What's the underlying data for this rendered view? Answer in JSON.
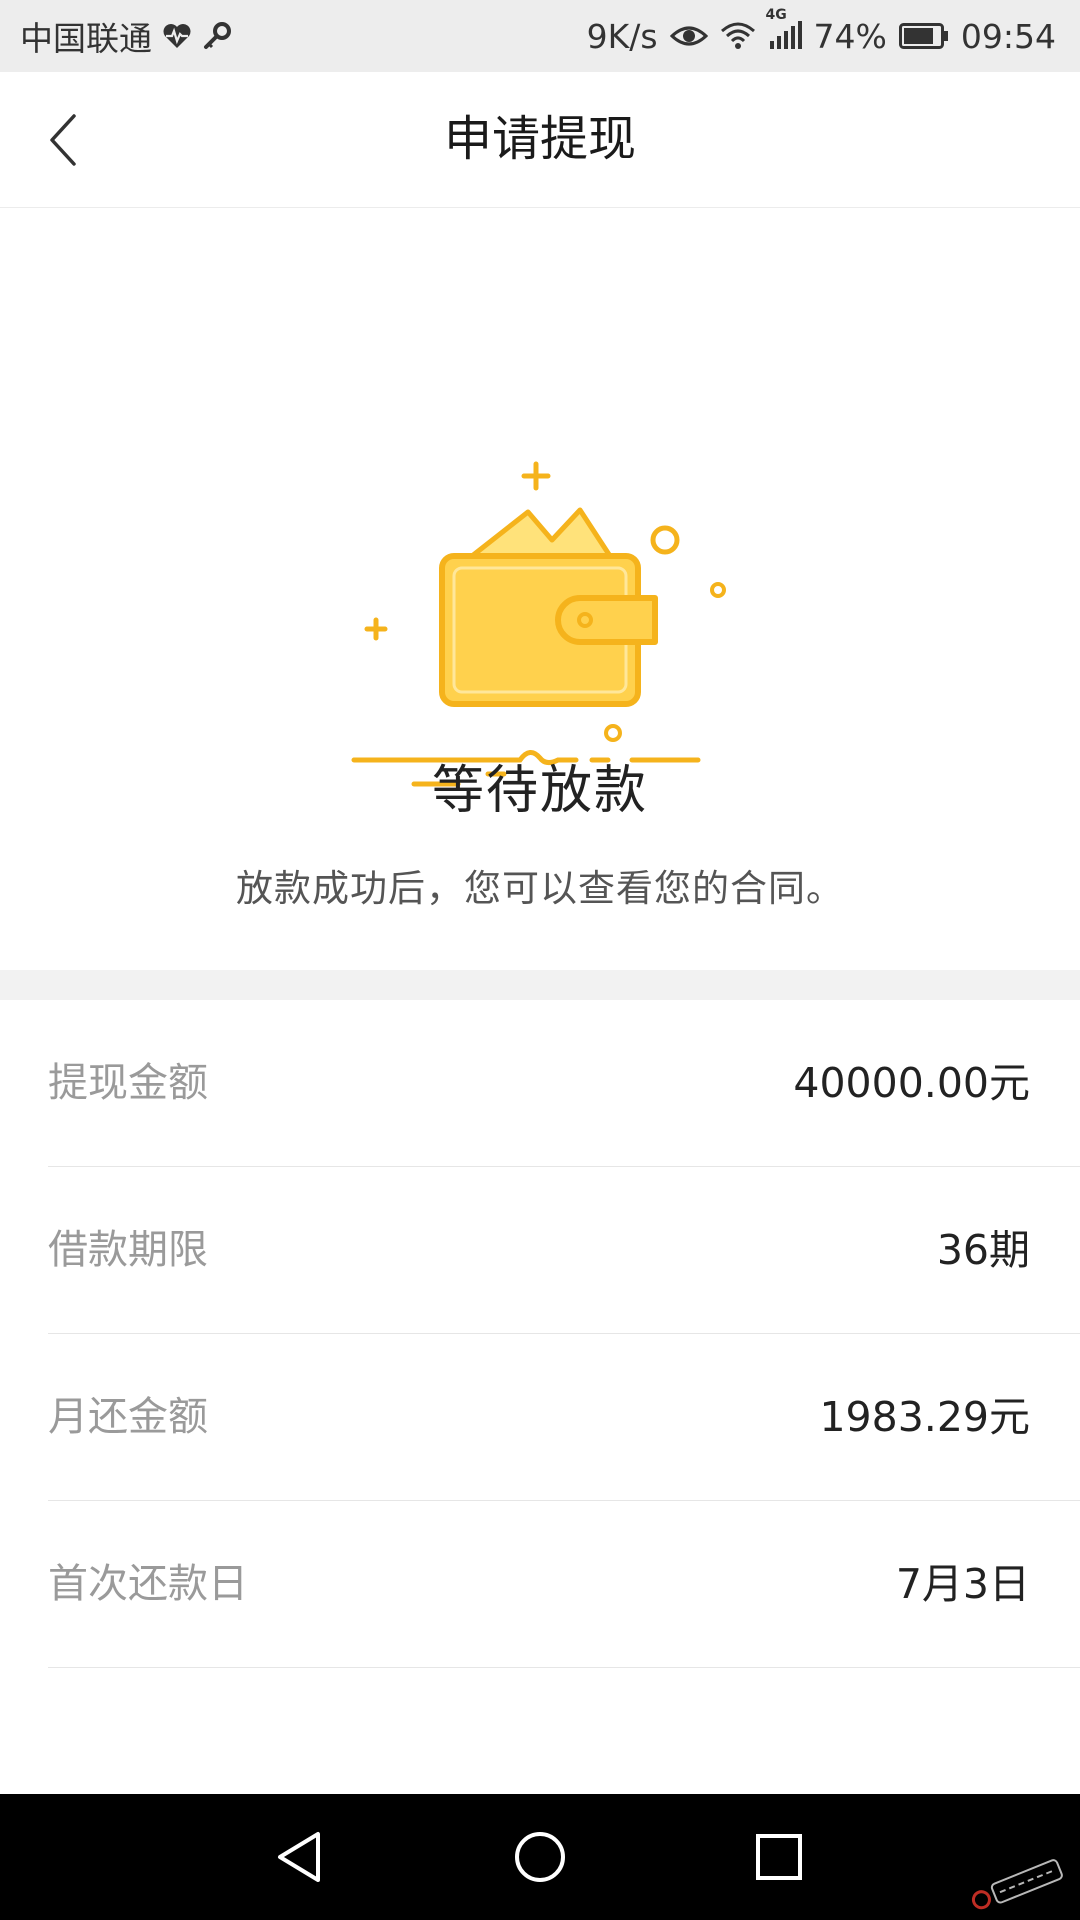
{
  "status_bar": {
    "carrier": "中国联通",
    "speed": "9K/s",
    "network": "4G",
    "battery": "74%",
    "time": "09:54",
    "icons": [
      "heart-pulse-icon",
      "key-icon",
      "eye-icon",
      "wifi-icon",
      "signal-icon",
      "battery-icon"
    ]
  },
  "nav": {
    "title": "申请提现",
    "back_icon": "chevron-left-icon"
  },
  "hero": {
    "illustration": "wallet-icon",
    "title": "等待放款",
    "subtitle": "放款成功后，您可以查看您的合同。"
  },
  "details": [
    {
      "label": "提现金额",
      "value": "40000.00元"
    },
    {
      "label": "借款期限",
      "value": "36期"
    },
    {
      "label": "月还金额",
      "value": "1983.29元"
    },
    {
      "label": "首次还款日",
      "value": "7月3日"
    }
  ],
  "system_nav": [
    "back-triangle-icon",
    "home-circle-icon",
    "recent-square-icon"
  ],
  "colors": {
    "accent": "#f5b31c",
    "wallet_fill": "#ffd14d",
    "status_bar_bg": "#ededed",
    "section_divider": "#f2f2f2",
    "label_gray": "#9a9a9a"
  }
}
